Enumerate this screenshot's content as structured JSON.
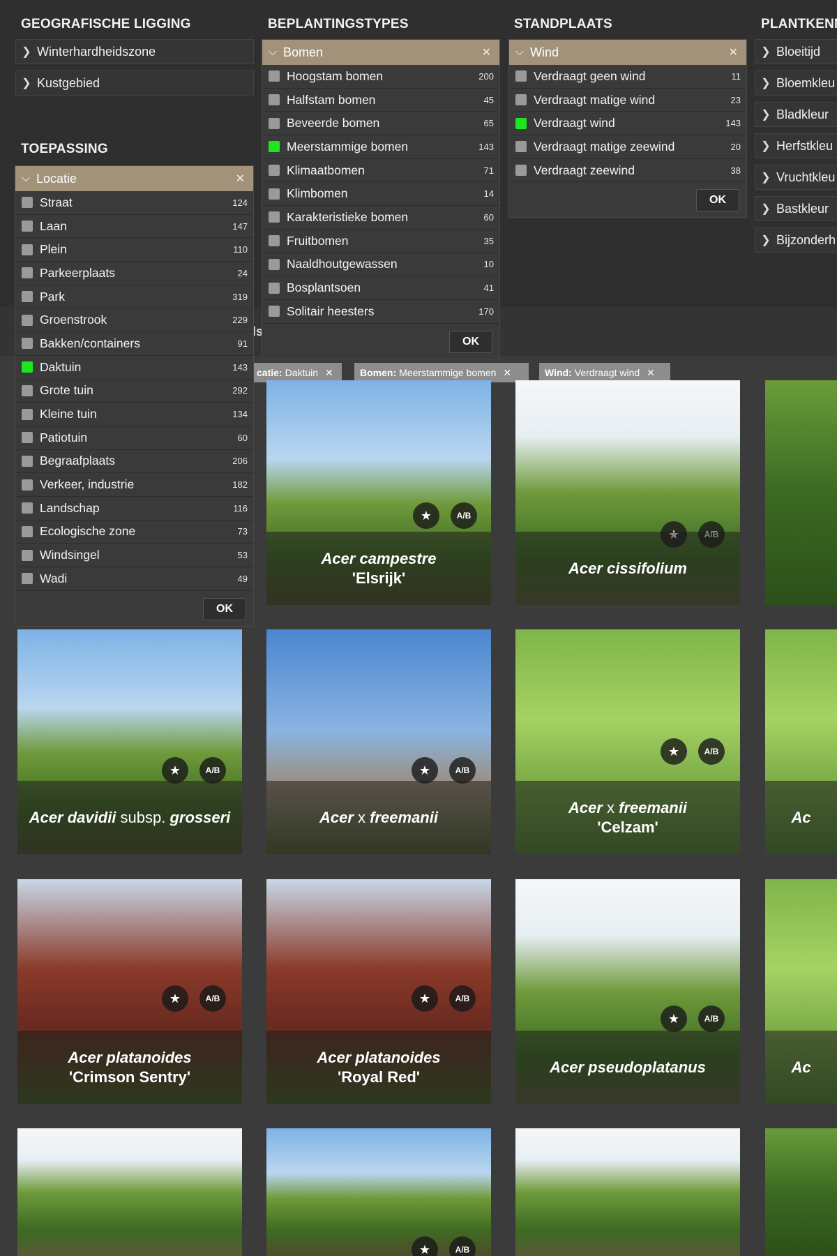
{
  "filters": {
    "geo": {
      "title": "GEOGRAFISCHE LIGGING",
      "items": [
        "Winterhardheidszone",
        "Kustgebied"
      ]
    },
    "toepassing": {
      "title": "TOEPASSING",
      "panel": {
        "label": "Locatie",
        "ok": "OK",
        "options": [
          {
            "label": "Straat",
            "count": "124",
            "checked": false
          },
          {
            "label": "Laan",
            "count": "147",
            "checked": false
          },
          {
            "label": "Plein",
            "count": "110",
            "checked": false
          },
          {
            "label": "Parkeerplaats",
            "count": "24",
            "checked": false
          },
          {
            "label": "Park",
            "count": "319",
            "checked": false
          },
          {
            "label": "Groenstrook",
            "count": "229",
            "checked": false
          },
          {
            "label": "Bakken/containers",
            "count": "91",
            "checked": false
          },
          {
            "label": "Daktuin",
            "count": "143",
            "checked": true
          },
          {
            "label": "Grote tuin",
            "count": "292",
            "checked": false
          },
          {
            "label": "Kleine tuin",
            "count": "134",
            "checked": false
          },
          {
            "label": "Patiotuin",
            "count": "60",
            "checked": false
          },
          {
            "label": "Begraafplaats",
            "count": "206",
            "checked": false
          },
          {
            "label": "Verkeer, industrie",
            "count": "182",
            "checked": false
          },
          {
            "label": "Landschap",
            "count": "116",
            "checked": false
          },
          {
            "label": "Ecologische zone",
            "count": "73",
            "checked": false
          },
          {
            "label": "Windsingel",
            "count": "53",
            "checked": false
          },
          {
            "label": "Wadi",
            "count": "49",
            "checked": false
          }
        ]
      }
    },
    "beplantingstypes": {
      "title": "BEPLANTINGSTYPES",
      "panel": {
        "label": "Bomen",
        "ok": "OK",
        "options": [
          {
            "label": "Hoogstam bomen",
            "count": "200",
            "checked": false
          },
          {
            "label": "Halfstam bomen",
            "count": "45",
            "checked": false
          },
          {
            "label": "Beveerde bomen",
            "count": "65",
            "checked": false
          },
          {
            "label": "Meerstammige bomen",
            "count": "143",
            "checked": true
          },
          {
            "label": "Klimaatbomen",
            "count": "71",
            "checked": false
          },
          {
            "label": "Klimbomen",
            "count": "14",
            "checked": false
          },
          {
            "label": "Karakteristieke bomen",
            "count": "60",
            "checked": false
          },
          {
            "label": "Fruitbomen",
            "count": "35",
            "checked": false
          },
          {
            "label": "Naaldhoutgewassen",
            "count": "10",
            "checked": false
          },
          {
            "label": "Bosplantsoen",
            "count": "41",
            "checked": false
          },
          {
            "label": "Solitair heesters",
            "count": "170",
            "checked": false
          }
        ]
      }
    },
    "standplaats": {
      "title": "STANDPLAATS",
      "panel": {
        "label": "Wind",
        "ok": "OK",
        "options": [
          {
            "label": "Verdraagt geen wind",
            "count": "11",
            "checked": false
          },
          {
            "label": "Verdraagt matige wind",
            "count": "23",
            "checked": false
          },
          {
            "label": "Verdraagt wind",
            "count": "143",
            "checked": true
          },
          {
            "label": "Verdraagt matige zeewind",
            "count": "20",
            "checked": false
          },
          {
            "label": "Verdraagt zeewind",
            "count": "38",
            "checked": false
          }
        ]
      }
    },
    "plantkenmerken": {
      "title": "PLANTKENN",
      "items": [
        "Bloeitijd",
        "Bloemkleu",
        "Bladkleur",
        "Herfstkleu",
        "Vruchtkleu",
        "Bastkleur",
        "Bijzonderh"
      ]
    }
  },
  "behind_text": "ls",
  "active_chips": [
    {
      "key": "catie:",
      "value": "Daktuin"
    },
    {
      "key": "Bomen:",
      "value": "Meerstammige bomen"
    },
    {
      "key": "Wind:",
      "value": "Verdraagt wind"
    }
  ],
  "results": [
    {
      "name_lines": [
        [
          "Acer campestre",
          ""
        ]
      ],
      "cultivar": "'Elsrijk'"
    },
    {
      "name_lines": [
        [
          "Acer cissifolium",
          ""
        ]
      ],
      "cultivar": ""
    },
    {
      "name_lines": [
        [
          "Acer davidii",
          " subsp. "
        ],
        [
          "grosseri",
          ""
        ]
      ],
      "cultivar": ""
    },
    {
      "name_lines": [
        [
          "Acer",
          " x "
        ],
        [
          "freemanii",
          ""
        ]
      ],
      "cultivar": ""
    },
    {
      "name_lines": [
        [
          "Acer",
          " x "
        ],
        [
          "freemanii",
          ""
        ]
      ],
      "cultivar": "'Celzam'"
    },
    {
      "name_lines": [
        [
          "Acer platanoides",
          ""
        ]
      ],
      "cultivar": "'Crimson Sentry'"
    },
    {
      "name_lines": [
        [
          "Acer platanoides",
          ""
        ]
      ],
      "cultivar": "'Royal Red'"
    },
    {
      "name_lines": [
        [
          "Acer pseudoplatanus",
          ""
        ]
      ],
      "cultivar": ""
    },
    {
      "name_lines": [
        [
          "Ac",
          ""
        ]
      ],
      "cultivar": ""
    },
    {
      "name_lines": [
        [
          "Ac",
          ""
        ]
      ],
      "cultivar": ""
    }
  ],
  "icons": {
    "favorite": "star-icon",
    "compare": "ab-compare-icon",
    "expand": "chevron-right-icon",
    "collapse": "chevron-down-icon",
    "close": "close-icon"
  },
  "colors": {
    "panel_header": "#a2927a",
    "checked": "#1ee61e",
    "chip": "#8d8d8d"
  }
}
